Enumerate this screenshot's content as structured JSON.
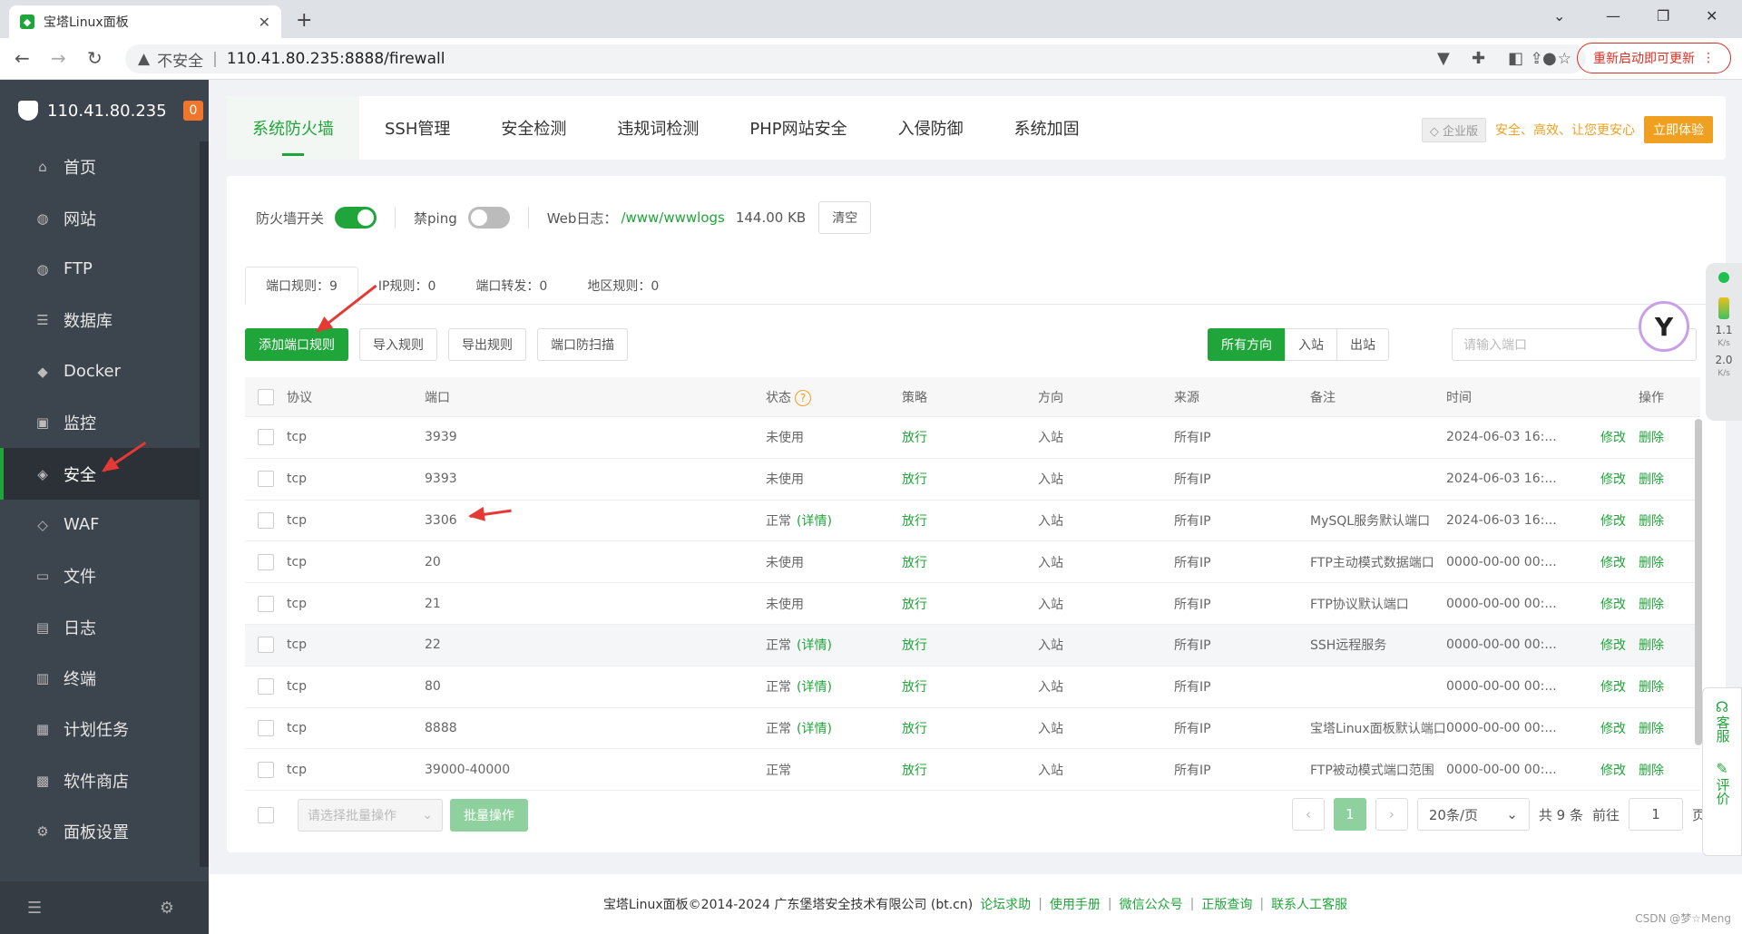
{
  "browser": {
    "tab_title": "宝塔Linux面板",
    "new_tab": "+",
    "close_tab": "✕",
    "insecure_label": "不安全",
    "url": "110.41.80.235:8888/firewall",
    "update_label": "重新启动即可更新"
  },
  "sidebar": {
    "server_ip": "110.41.80.235",
    "badge": "0",
    "items": [
      {
        "label": "首页",
        "icon": "home-icon",
        "glyph": "⌂"
      },
      {
        "label": "网站",
        "icon": "globe-icon",
        "glyph": "◍"
      },
      {
        "label": "FTP",
        "icon": "ftp-icon",
        "glyph": "◍"
      },
      {
        "label": "数据库",
        "icon": "database-icon",
        "glyph": "☰"
      },
      {
        "label": "Docker",
        "icon": "docker-icon",
        "glyph": "◆"
      },
      {
        "label": "监控",
        "icon": "monitor-icon",
        "glyph": "▣"
      },
      {
        "label": "安全",
        "icon": "security-icon",
        "glyph": "◈"
      },
      {
        "label": "WAF",
        "icon": "waf-icon",
        "glyph": "◇"
      },
      {
        "label": "文件",
        "icon": "folder-icon",
        "glyph": "▭"
      },
      {
        "label": "日志",
        "icon": "log-icon",
        "glyph": "▤"
      },
      {
        "label": "终端",
        "icon": "terminal-icon",
        "glyph": "▥"
      },
      {
        "label": "计划任务",
        "icon": "calendar-icon",
        "glyph": "▦"
      },
      {
        "label": "软件商店",
        "icon": "store-icon",
        "glyph": "▩"
      },
      {
        "label": "面板设置",
        "icon": "settings-icon",
        "glyph": "⚙"
      }
    ],
    "active_index": 6
  },
  "topnav": {
    "tabs": [
      "系统防火墙",
      "SSH管理",
      "安全检测",
      "违规词检测",
      "PHP网站安全",
      "入侵防御",
      "系统加固"
    ],
    "enterprise": "企业版",
    "slogan": "安全、高效、让您更安心",
    "try_label": "立即体验"
  },
  "controls": {
    "firewall_label": "防火墙开关",
    "ping_label": "禁ping",
    "weblog_label": "Web日志：",
    "weblog_path": "/www/wwwlogs",
    "weblog_size": "144.00 KB",
    "clear_label": "清空"
  },
  "subtabs": [
    "端口规则：9",
    "IP规则：0",
    "端口转发：0",
    "地区规则：0"
  ],
  "actions": {
    "add": "添加端口规则",
    "import": "导入规则",
    "export": "导出规则",
    "scan": "端口防扫描",
    "dir_all": "所有方向",
    "dir_in": "入站",
    "dir_out": "出站",
    "search_placeholder": "请输入端口"
  },
  "table": {
    "headers": {
      "proto": "协议",
      "port": "端口",
      "status": "状态",
      "policy": "策略",
      "direction": "方向",
      "source": "来源",
      "note": "备注",
      "time": "时间",
      "op": "操作"
    },
    "edit_label": "修改",
    "delete_label": "删除",
    "rows": [
      {
        "proto": "tcp",
        "port": "3939",
        "status": "未使用",
        "detail": "",
        "policy": "放行",
        "direction": "入站",
        "source": "所有IP",
        "note": "",
        "time": "2024-06-03 16:..."
      },
      {
        "proto": "tcp",
        "port": "9393",
        "status": "未使用",
        "detail": "",
        "policy": "放行",
        "direction": "入站",
        "source": "所有IP",
        "note": "",
        "time": "2024-06-03 16:..."
      },
      {
        "proto": "tcp",
        "port": "3306",
        "status": "正常",
        "detail": "(详情)",
        "policy": "放行",
        "direction": "入站",
        "source": "所有IP",
        "note": "MySQL服务默认端口",
        "time": "2024-06-03 16:..."
      },
      {
        "proto": "tcp",
        "port": "20",
        "status": "未使用",
        "detail": "",
        "policy": "放行",
        "direction": "入站",
        "source": "所有IP",
        "note": "FTP主动模式数据端口",
        "time": "0000-00-00 00:..."
      },
      {
        "proto": "tcp",
        "port": "21",
        "status": "未使用",
        "detail": "",
        "policy": "放行",
        "direction": "入站",
        "source": "所有IP",
        "note": "FTP协议默认端口",
        "time": "0000-00-00 00:..."
      },
      {
        "proto": "tcp",
        "port": "22",
        "status": "正常",
        "detail": "(详情)",
        "policy": "放行",
        "direction": "入站",
        "source": "所有IP",
        "note": "SSH远程服务",
        "time": "0000-00-00 00:..."
      },
      {
        "proto": "tcp",
        "port": "80",
        "status": "正常",
        "detail": "(详情)",
        "policy": "放行",
        "direction": "入站",
        "source": "所有IP",
        "note": "",
        "time": "0000-00-00 00:..."
      },
      {
        "proto": "tcp",
        "port": "8888",
        "status": "正常",
        "detail": "(详情)",
        "policy": "放行",
        "direction": "入站",
        "source": "所有IP",
        "note": "宝塔Linux面板默认端口",
        "time": "0000-00-00 00:..."
      },
      {
        "proto": "tcp",
        "port": "39000-40000",
        "status": "正常",
        "detail": "",
        "policy": "放行",
        "direction": "入站",
        "source": "所有IP",
        "note": "FTP被动模式端口范围",
        "time": "0000-00-00 00:..."
      }
    ]
  },
  "footer": {
    "batch_placeholder": "请选择批量操作",
    "batch_label": "批量操作",
    "page_current": "1",
    "page_size": "20条/页",
    "total": "共 9 条",
    "goto_label": "前往",
    "goto_value": "1",
    "page_unit": "页"
  },
  "copyright": {
    "text": "宝塔Linux面板©2014-2024 广东堡塔安全技术有限公司 (bt.cn)",
    "links": [
      "论坛求助",
      "使用手册",
      "微信公众号",
      "正版查询",
      "联系人工客服"
    ]
  },
  "widgets": {
    "up_rate": "1.1",
    "down_rate": "2.0",
    "rate_unit": "K/s",
    "service": "客服",
    "review": "评价"
  },
  "watermark": "CSDN @梦☆Meng",
  "colors": {
    "accent": "#20a53a",
    "sidebar": "#3c444d",
    "annotation": "#e53935",
    "promo": "#f0a020"
  }
}
